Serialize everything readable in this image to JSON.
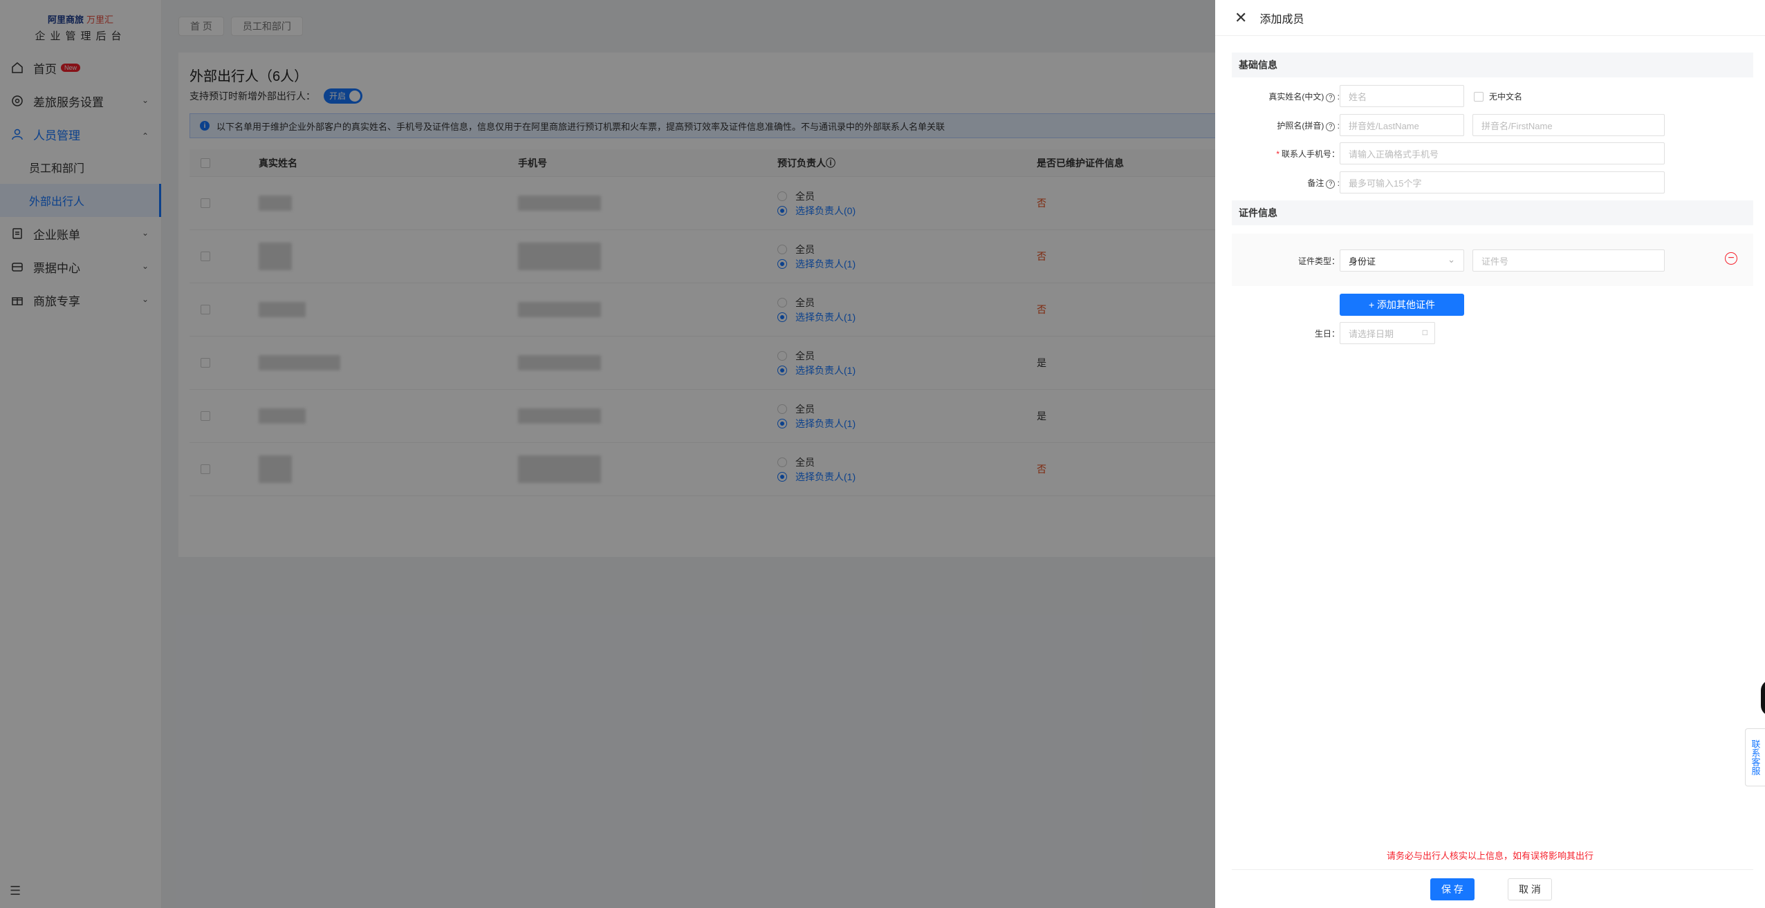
{
  "sidebar": {
    "logo_line1a": "阿里商旅",
    "logo_line1b": "万里汇",
    "logo_line2": "企业管理后台",
    "items": [
      {
        "label": "首页",
        "badge": "New",
        "icon": "home-icon"
      },
      {
        "label": "差旅服务设置",
        "icon": "settings-icon"
      },
      {
        "label": "人员管理",
        "icon": "user-icon"
      },
      {
        "label": "员工和部门"
      },
      {
        "label": "外部出行人"
      },
      {
        "label": "企业账单",
        "icon": "bill-icon"
      },
      {
        "label": "票据中心",
        "icon": "ticket-icon"
      },
      {
        "label": "商旅专享",
        "icon": "gift-icon"
      }
    ]
  },
  "breadcrumbs": [
    "首 页",
    "员工和部门"
  ],
  "card": {
    "title": "外部出行人（6人）",
    "toggle_label": "支持预订时新增外部出行人：",
    "toggle_value": "开启",
    "info": "以下名单用于维护企业外部客户的真实姓名、手机号及证件信息，信息仅用于在阿里商旅进行预订机票和火车票，提高预订效率及证件信息准确性。不与通讯录中的外部联系人名单关联",
    "columns": [
      "真实姓名",
      "手机号",
      "预订负责人ⓘ",
      "是否已维护证件信息"
    ],
    "rows": [
      {
        "opt1": "全员",
        "opt2": "选择负责人(0)",
        "cert": "否"
      },
      {
        "opt1": "全员",
        "opt2": "选择负责人(1)",
        "cert": "否"
      },
      {
        "opt1": "全员",
        "opt2": "选择负责人(1)",
        "cert": "否"
      },
      {
        "opt1": "全员",
        "opt2": "选择负责人(1)",
        "cert": "是"
      },
      {
        "opt1": "全员",
        "opt2": "选择负责人(1)",
        "cert": "是"
      },
      {
        "opt1": "全员",
        "opt2": "选择负责人(1)",
        "cert": "否"
      }
    ]
  },
  "drawer": {
    "title": "添加成员",
    "section_basic": "基础信息",
    "name_label": "真实姓名(中文)",
    "name_placeholder": "姓名",
    "no_chinese": "无中文名",
    "passport_label": "护照名(拼音)",
    "last_placeholder": "拼音姓/LastName",
    "first_placeholder": "拼音名/FirstName",
    "phone_label": "联系人手机号：",
    "phone_placeholder": "请输入正确格式手机号",
    "remark_label": "备注",
    "remark_placeholder": "最多可输入15个字",
    "section_cert": "证件信息",
    "cert_type_label": "证件类型：",
    "cert_type_value": "身份证",
    "cert_no_placeholder": "证件号",
    "add_cert": "+ 添加其他证件",
    "birthday_label": "生日：",
    "birthday_placeholder": "请选择日期",
    "warning": "请务必与出行人核实以上信息，如有误将影响其出行",
    "save": "保 存",
    "cancel": "取 消"
  },
  "service": "联系客服"
}
